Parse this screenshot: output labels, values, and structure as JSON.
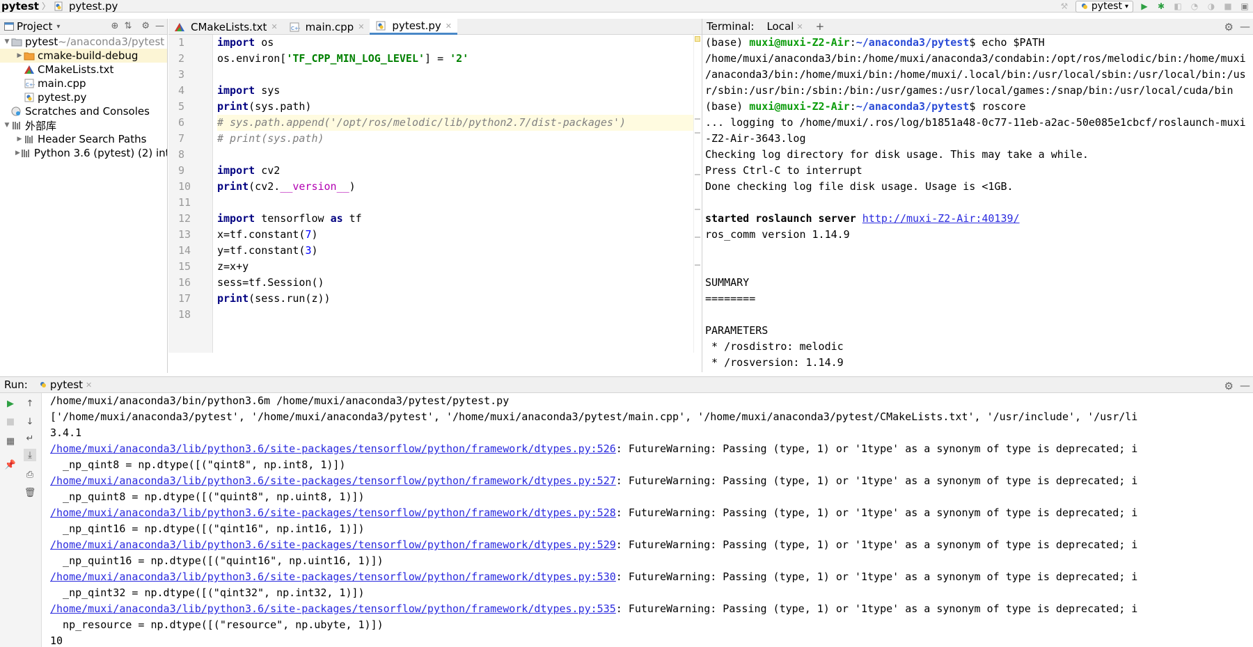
{
  "breadcrumb": {
    "project": "pytest",
    "file": "pytest.py"
  },
  "run_config": {
    "name": "pytest"
  },
  "project_panel": {
    "title": "Project",
    "tree": [
      {
        "label": "pytest",
        "suffix": "~/anaconda3/pytest",
        "level": 0,
        "icon": "folder-icon",
        "expanded": true
      },
      {
        "label": "cmake-build-debug",
        "level": 1,
        "icon": "folder-orange-icon",
        "expanded": false,
        "selected": true
      },
      {
        "label": "CMakeLists.txt",
        "level": 1,
        "icon": "cmake-icon"
      },
      {
        "label": "main.cpp",
        "level": 1,
        "icon": "cpp-file-icon"
      },
      {
        "label": "pytest.py",
        "level": 1,
        "icon": "python-file-icon"
      },
      {
        "label": "Scratches and Consoles",
        "level": 0,
        "icon": "scratches-icon"
      },
      {
        "label": "外部库",
        "level": 0,
        "icon": "library-icon",
        "expanded": true
      },
      {
        "label": "Header Search Paths",
        "level": 1,
        "icon": "library-icon",
        "expanded": false
      },
      {
        "label": "Python 3.6 (pytest) (2) inte",
        "level": 1,
        "icon": "library-icon",
        "expanded": false
      }
    ]
  },
  "editor": {
    "tabs": [
      {
        "label": "CMakeLists.txt",
        "icon": "cmake-icon"
      },
      {
        "label": "main.cpp",
        "icon": "cpp-file-icon"
      },
      {
        "label": "pytest.py",
        "icon": "python-file-icon",
        "active": true
      }
    ],
    "line_numbers": [
      "1",
      "2",
      "3",
      "4",
      "5",
      "6",
      "7",
      "8",
      "9",
      "10",
      "11",
      "12",
      "13",
      "14",
      "15",
      "16",
      "17",
      "18"
    ],
    "lines": [
      [
        [
          "kw",
          "import"
        ],
        [
          "t",
          " os"
        ]
      ],
      [
        [
          "t",
          "os.environ["
        ],
        [
          "str",
          "'TF_CPP_MIN_LOG_LEVEL'"
        ],
        [
          "t",
          "] = "
        ],
        [
          "str",
          "'2'"
        ]
      ],
      [],
      [
        [
          "kw",
          "import"
        ],
        [
          "t",
          " sys"
        ]
      ],
      [
        [
          "kw",
          "print"
        ],
        [
          "t",
          "(sys.path)"
        ]
      ],
      [
        [
          "cmt",
          "# sys.path.append('/opt/ros/melodic/lib/python2.7/dist-packages')"
        ]
      ],
      [
        [
          "cmt",
          "# print(sys.path)"
        ]
      ],
      [],
      [
        [
          "kw",
          "import"
        ],
        [
          "t",
          " cv2"
        ]
      ],
      [
        [
          "kw",
          "print"
        ],
        [
          "t",
          "(cv2."
        ],
        [
          "dun",
          "__version__"
        ],
        [
          "t",
          ")"
        ]
      ],
      [],
      [
        [
          "kw",
          "import"
        ],
        [
          "t",
          " tensorflow "
        ],
        [
          "kw",
          "as"
        ],
        [
          "t",
          " tf"
        ]
      ],
      [
        [
          "t",
          "x=tf.constant("
        ],
        [
          "num",
          "7"
        ],
        [
          "t",
          ")"
        ]
      ],
      [
        [
          "t",
          "y=tf.constant("
        ],
        [
          "num",
          "3"
        ],
        [
          "t",
          ")"
        ]
      ],
      [
        [
          "t",
          "z=x+y"
        ]
      ],
      [
        [
          "t",
          "sess=tf.Session()"
        ]
      ],
      [
        [
          "kw",
          "print"
        ],
        [
          "t",
          "(sess.run(z))"
        ]
      ],
      []
    ]
  },
  "terminal": {
    "title": "Terminal:",
    "tab": "Local",
    "lines": [
      [
        [
          "t",
          "(base) "
        ],
        [
          "user",
          "muxi@muxi-Z2-Air"
        ],
        [
          "t",
          ":"
        ],
        [
          "path",
          "~/anaconda3/pytest"
        ],
        [
          "t",
          "$ echo $PATH"
        ]
      ],
      [
        [
          "t",
          "/home/muxi/anaconda3/bin:/home/muxi/anaconda3/condabin:/opt/ros/melodic/bin:/home/muxi"
        ]
      ],
      [
        [
          "t",
          "/anaconda3/bin:/home/muxi/bin:/home/muxi/.local/bin:/usr/local/sbin:/usr/local/bin:/us"
        ]
      ],
      [
        [
          "t",
          "r/sbin:/usr/bin:/sbin:/bin:/usr/games:/usr/local/games:/snap/bin:/usr/local/cuda/bin"
        ]
      ],
      [
        [
          "t",
          "(base) "
        ],
        [
          "user",
          "muxi@muxi-Z2-Air"
        ],
        [
          "t",
          ":"
        ],
        [
          "path",
          "~/anaconda3/pytest"
        ],
        [
          "t",
          "$ roscore"
        ]
      ],
      [
        [
          "t",
          "... logging to /home/muxi/.ros/log/b1851a48-0c77-11eb-a2ac-50e085e1cbcf/roslaunch-muxi"
        ]
      ],
      [
        [
          "t",
          "-Z2-Air-3643.log"
        ]
      ],
      [
        [
          "t",
          "Checking log directory for disk usage. This may take a while."
        ]
      ],
      [
        [
          "t",
          "Press Ctrl-C to interrupt"
        ]
      ],
      [
        [
          "t",
          "Done checking log file disk usage. Usage is <1GB."
        ]
      ],
      [],
      [
        [
          "b",
          "started roslaunch server "
        ],
        [
          "link",
          "http://muxi-Z2-Air:40139/"
        ]
      ],
      [
        [
          "t",
          "ros_comm version 1.14.9"
        ]
      ],
      [],
      [],
      [
        [
          "t",
          "SUMMARY"
        ]
      ],
      [
        [
          "t",
          "========"
        ]
      ],
      [],
      [
        [
          "t",
          "PARAMETERS"
        ]
      ],
      [
        [
          "t",
          " * /rosdistro: melodic"
        ]
      ],
      [
        [
          "t",
          " * /rosversion: 1.14.9"
        ]
      ]
    ]
  },
  "run_panel": {
    "title": "Run:",
    "tab": "pytest",
    "lines": [
      [
        [
          "t",
          "/home/muxi/anaconda3/bin/python3.6m /home/muxi/anaconda3/pytest/pytest.py"
        ]
      ],
      [
        [
          "t",
          "['/home/muxi/anaconda3/pytest', '/home/muxi/anaconda3/pytest', '/home/muxi/anaconda3/pytest/main.cpp', '/home/muxi/anaconda3/pytest/CMakeLists.txt', '/usr/include', '/usr/li"
        ]
      ],
      [
        [
          "t",
          "3.4.1"
        ]
      ],
      [
        [
          "link",
          "/home/muxi/anaconda3/lib/python3.6/site-packages/tensorflow/python/framework/dtypes.py:526"
        ],
        [
          "t",
          ": FutureWarning: Passing (type, 1) or '1type' as a synonym of type is deprecated; i"
        ]
      ],
      [
        [
          "t",
          "  _np_qint8 = np.dtype([(\"qint8\", np.int8, 1)])"
        ]
      ],
      [
        [
          "link",
          "/home/muxi/anaconda3/lib/python3.6/site-packages/tensorflow/python/framework/dtypes.py:527"
        ],
        [
          "t",
          ": FutureWarning: Passing (type, 1) or '1type' as a synonym of type is deprecated; i"
        ]
      ],
      [
        [
          "t",
          "  _np_quint8 = np.dtype([(\"quint8\", np.uint8, 1)])"
        ]
      ],
      [
        [
          "link",
          "/home/muxi/anaconda3/lib/python3.6/site-packages/tensorflow/python/framework/dtypes.py:528"
        ],
        [
          "t",
          ": FutureWarning: Passing (type, 1) or '1type' as a synonym of type is deprecated; i"
        ]
      ],
      [
        [
          "t",
          "  _np_qint16 = np.dtype([(\"qint16\", np.int16, 1)])"
        ]
      ],
      [
        [
          "link",
          "/home/muxi/anaconda3/lib/python3.6/site-packages/tensorflow/python/framework/dtypes.py:529"
        ],
        [
          "t",
          ": FutureWarning: Passing (type, 1) or '1type' as a synonym of type is deprecated; i"
        ]
      ],
      [
        [
          "t",
          "  _np_quint16 = np.dtype([(\"quint16\", np.uint16, 1)])"
        ]
      ],
      [
        [
          "link",
          "/home/muxi/anaconda3/lib/python3.6/site-packages/tensorflow/python/framework/dtypes.py:530"
        ],
        [
          "t",
          ": FutureWarning: Passing (type, 1) or '1type' as a synonym of type is deprecated; i"
        ]
      ],
      [
        [
          "t",
          "  _np_qint32 = np.dtype([(\"qint32\", np.int32, 1)])"
        ]
      ],
      [
        [
          "link",
          "/home/muxi/anaconda3/lib/python3.6/site-packages/tensorflow/python/framework/dtypes.py:535"
        ],
        [
          "t",
          ": FutureWarning: Passing (type, 1) or '1type' as a synonym of type is deprecated; i"
        ]
      ],
      [
        [
          "t",
          "  np_resource = np.dtype([(\"resource\", np.ubyte, 1)])"
        ]
      ],
      [
        [
          "t",
          "10"
        ]
      ]
    ]
  },
  "colors": {
    "keyword": "#000080",
    "string": "#008000",
    "comment": "#808080",
    "number": "#0000ff",
    "prompt_user": "#0c9c0c",
    "prompt_path": "#2a4bd7",
    "link": "#2a2adf",
    "selection": "#fcf5d5",
    "run_green": "#2ea043"
  }
}
